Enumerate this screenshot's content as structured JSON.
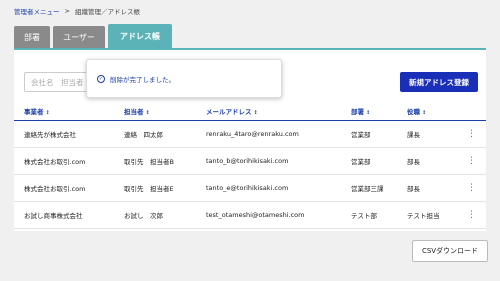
{
  "breadcrumb": {
    "items": [
      "管理者メニュー",
      "組織管理／アドレス帳"
    ],
    "separator": ">"
  },
  "tabs": [
    {
      "label": "部署",
      "active": false
    },
    {
      "label": "ユーザー",
      "active": false
    },
    {
      "label": "アドレス帳",
      "active": true
    }
  ],
  "search": {
    "placeholder": "会社名　担当者"
  },
  "new_button": {
    "label": "新規アドレス登録"
  },
  "toast": {
    "message": "削除が完了しました。",
    "icon": "check-circle-icon"
  },
  "table": {
    "columns": [
      "事業者",
      "担当者",
      "メールアドレス",
      "部署",
      "役職"
    ],
    "sort_icon": "↕",
    "row_menu_icon": "⋮",
    "rows": [
      {
        "company": "連絡先が株式会社",
        "person": "連絡　四太郎",
        "email": "renraku_4taro@renraku.com",
        "dept": "営業部",
        "title": "課長"
      },
      {
        "company": "株式会社お取引.com",
        "person": "取引先　担当者B",
        "email": "tanto_b@torihikisaki.com",
        "dept": "営業部",
        "title": "部長"
      },
      {
        "company": "株式会社お取引.com",
        "person": "取引先　担当者E",
        "email": "tanto_e@torihikisaki.com",
        "dept": "営業部三課",
        "title": "部長"
      },
      {
        "company": "お試し商事株式会社",
        "person": "お試し　次郎",
        "email": "test_otameshi@otameshi.com",
        "dept": "テスト部",
        "title": "テスト担当"
      }
    ]
  },
  "csv_button": {
    "label": "CSVダウンロード"
  },
  "colors": {
    "accent": "#5bb3b8",
    "primary": "#1a2fb8",
    "link": "#1a3faa",
    "tab_inactive": "#8a8a8a"
  }
}
